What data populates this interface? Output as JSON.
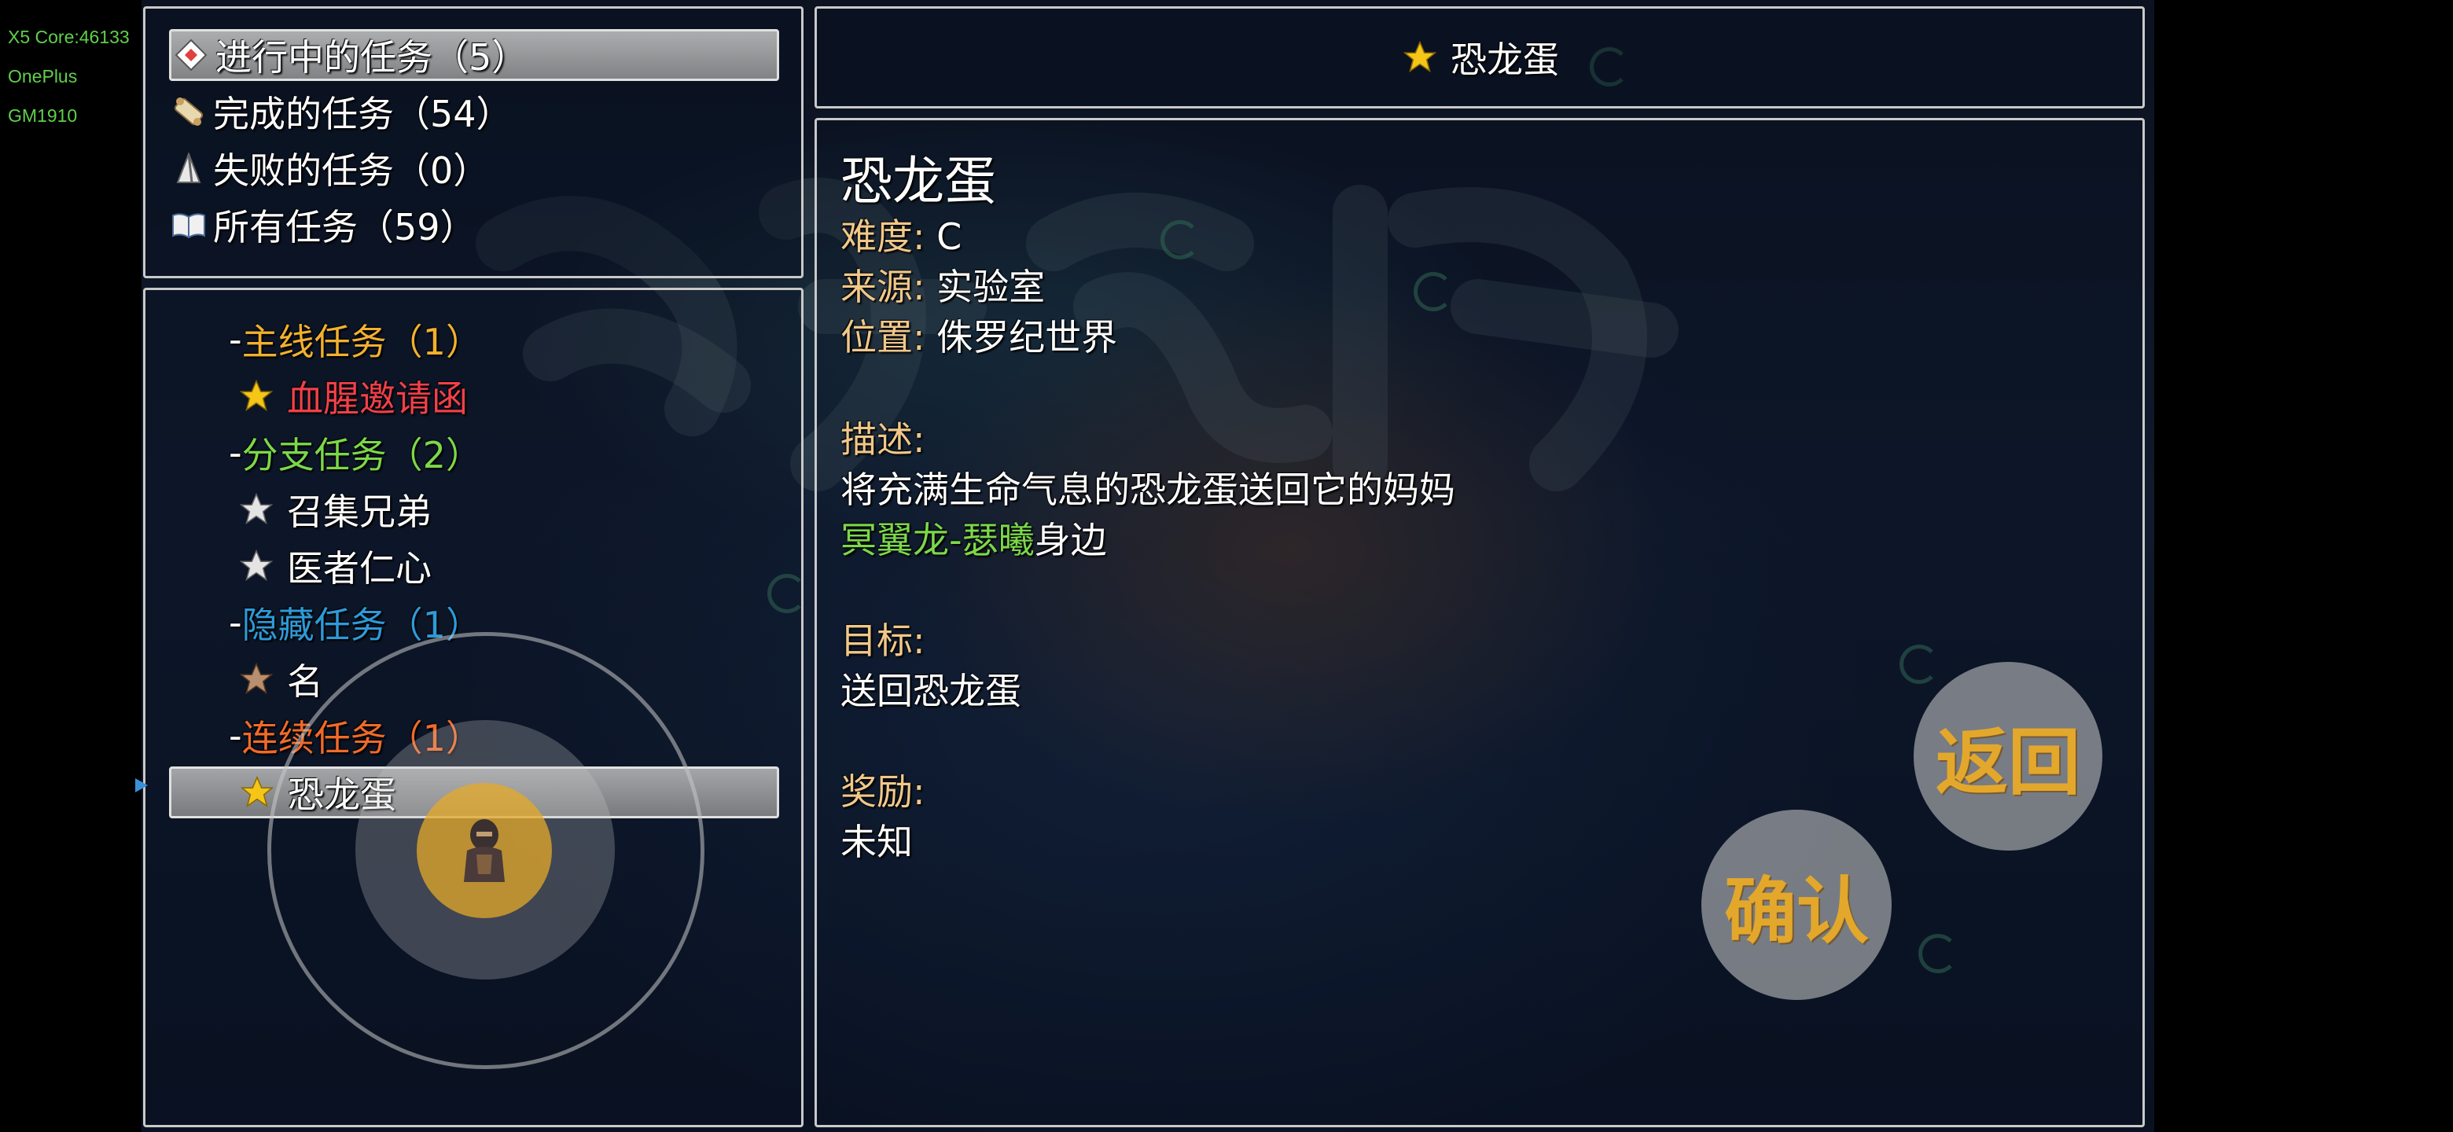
{
  "debug": {
    "line1": "X5 Core:46133",
    "line2": "OnePlus",
    "line3": "GM1910"
  },
  "categories": [
    {
      "label": "进行中的任务（5）",
      "icon": "letter-icon",
      "selected": true
    },
    {
      "label": "完成的任务（54）",
      "icon": "scroll-icon",
      "selected": false
    },
    {
      "label": "失败的任务（0）",
      "icon": "flag-icon",
      "selected": false
    },
    {
      "label": "所有任务（59）",
      "icon": "book-icon",
      "selected": false
    }
  ],
  "quest_list": {
    "groups": [
      {
        "dash": "-",
        "label": "主线任务（1）",
        "color": "#f0b030"
      },
      {
        "dash": "-",
        "label": "分支任务（2）",
        "color": "#7bd84a"
      },
      {
        "dash": "-",
        "label": "隐藏任务（1）",
        "color": "#2e9ad8"
      },
      {
        "dash": "-",
        "label": "连续任务（1）",
        "color": "#f06a2a"
      }
    ],
    "quests": [
      {
        "label": "血腥邀请函",
        "color": "#f0404a",
        "star": "gold-star-icon"
      },
      {
        "label": "召集兄弟",
        "color": "#ffffff",
        "star": "silver-star-icon"
      },
      {
        "label": "医者仁心",
        "color": "#ffffff",
        "star": "silver-star-icon"
      },
      {
        "label": "名",
        "color": "#ffffff",
        "star": "bronze-star-icon"
      },
      {
        "label": "恐龙蛋",
        "color": "#ffffff",
        "star": "gold-star-icon",
        "selected": true
      }
    ]
  },
  "header": {
    "title": "恐龙蛋"
  },
  "detail": {
    "title": "恐龙蛋",
    "difficulty_label": "难度:",
    "difficulty_value": "C",
    "source_label": "来源:",
    "source_value": "实验室",
    "location_label": "位置:",
    "location_value": "侏罗纪世界",
    "description_label": "描述:",
    "description_line1": "将充满生命气息的恐龙蛋送回它的妈妈",
    "description_line2_highlight": "冥翼龙-瑟曦",
    "description_line2_rest": "身边",
    "objective_label": "目标:",
    "objective_value": "送回恐龙蛋",
    "reward_label": "奖励:",
    "reward_value": "未知"
  },
  "buttons": {
    "back": "返回",
    "confirm": "确认"
  },
  "colors": {
    "gold": "#f5c518",
    "label": "#f0c88a",
    "highlight_green": "#7bd84a"
  }
}
